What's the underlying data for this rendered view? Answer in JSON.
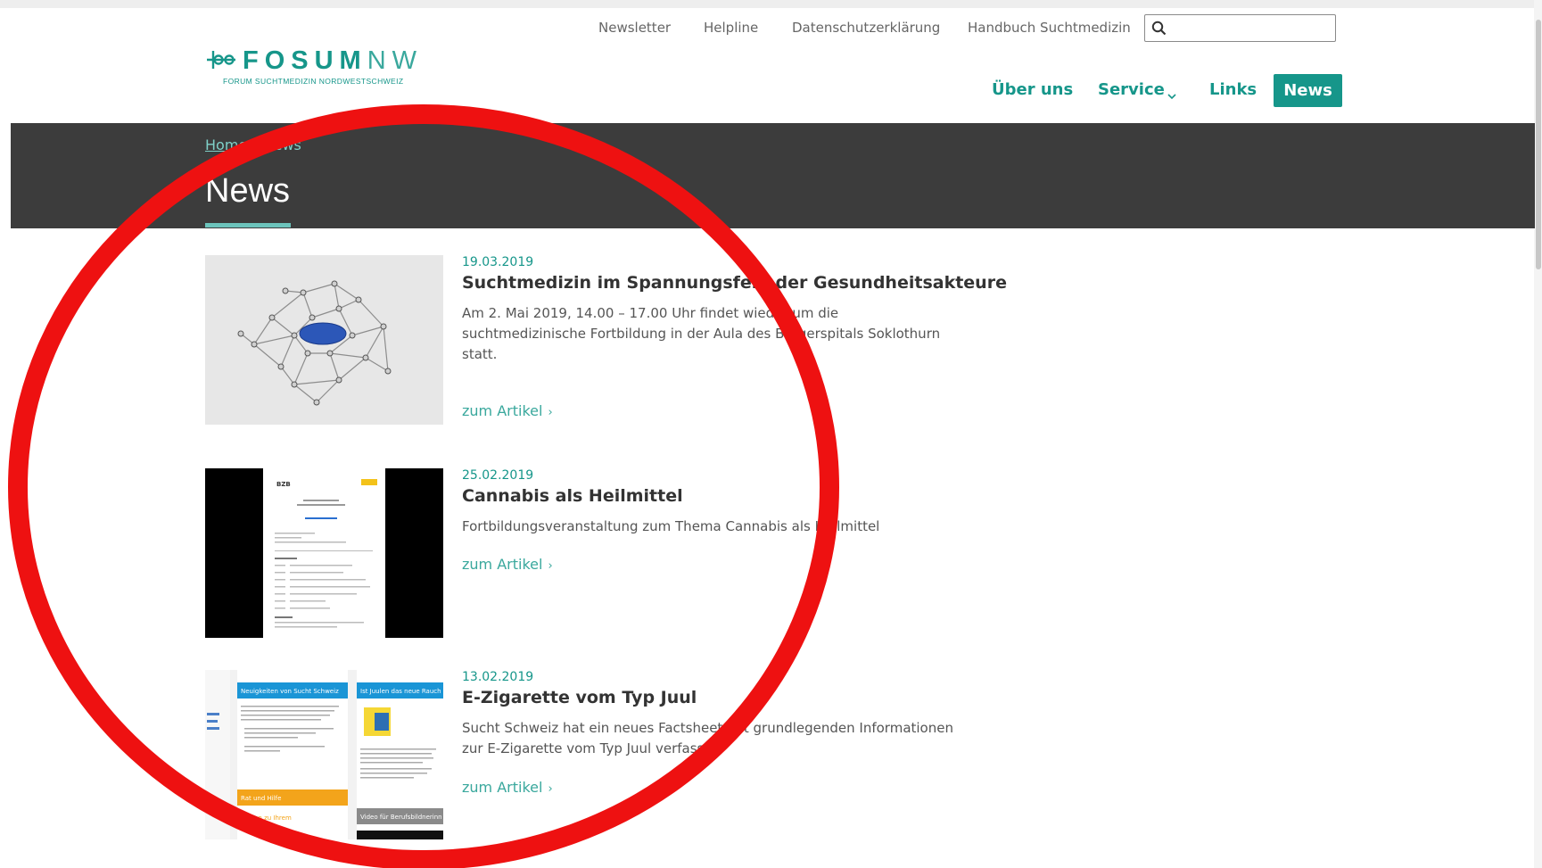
{
  "utility_nav": [
    "Newsletter",
    "Helpline",
    "Datenschutzerklärung",
    "Handbuch Suchtmedizin"
  ],
  "search": {
    "placeholder": "",
    "value": ""
  },
  "logo": {
    "name_bold": "FOSUM",
    "name_thin": "NW",
    "subtitle": "FORUM SUCHTMEDIZIN NORDWESTSCHWEIZ"
  },
  "main_nav": {
    "about": "Über uns",
    "service": "Service",
    "links": "Links",
    "news": "News"
  },
  "breadcrumb": {
    "home": "Home",
    "current": "News"
  },
  "page_title": "News",
  "articles": [
    {
      "date": "19.03.2019",
      "title": "Suchtmedizin im Spannungsfeld der Gesundheitsakteure",
      "teaser": "Am 2. Mai 2019, 14.00 – 17.00 Uhr findet wieder um die suchtmedizinische Fortbildung  in der Aula des Bürgerspitals Soklothurn statt.",
      "link": "zum Artikel"
    },
    {
      "date": "25.02.2019",
      "title": "Cannabis als Heilmittel",
      "teaser": "Fortbildungsveranstaltung zum Thema Cannabis als Heilmittel",
      "link": "zum Artikel"
    },
    {
      "date": "13.02.2019",
      "title": "E-Zigarette vom Typ Juul",
      "teaser": "Sucht Schweiz hat ein neues Factsheet mit grundlegenden Informationen zur E-Zigarette vom Typ Juul verfasst.",
      "link": "zum Artikel"
    }
  ],
  "thumbnail_text": {
    "doc_logo": "BZB",
    "newsletter_header": "Neuigkeiten von Sucht Schweiz",
    "newsletter_side_header": "Ist Juulen das neue Rauch",
    "newsletter_orange": "Rat und Hilfe",
    "newsletter_orange_text": "Fragen zu Ihrem",
    "newsletter_video": "Video für Berufsbildnerinn"
  },
  "colors": {
    "accent": "#16968a",
    "hero_bg": "#3c3c3c",
    "annotation": "#ee1111"
  }
}
